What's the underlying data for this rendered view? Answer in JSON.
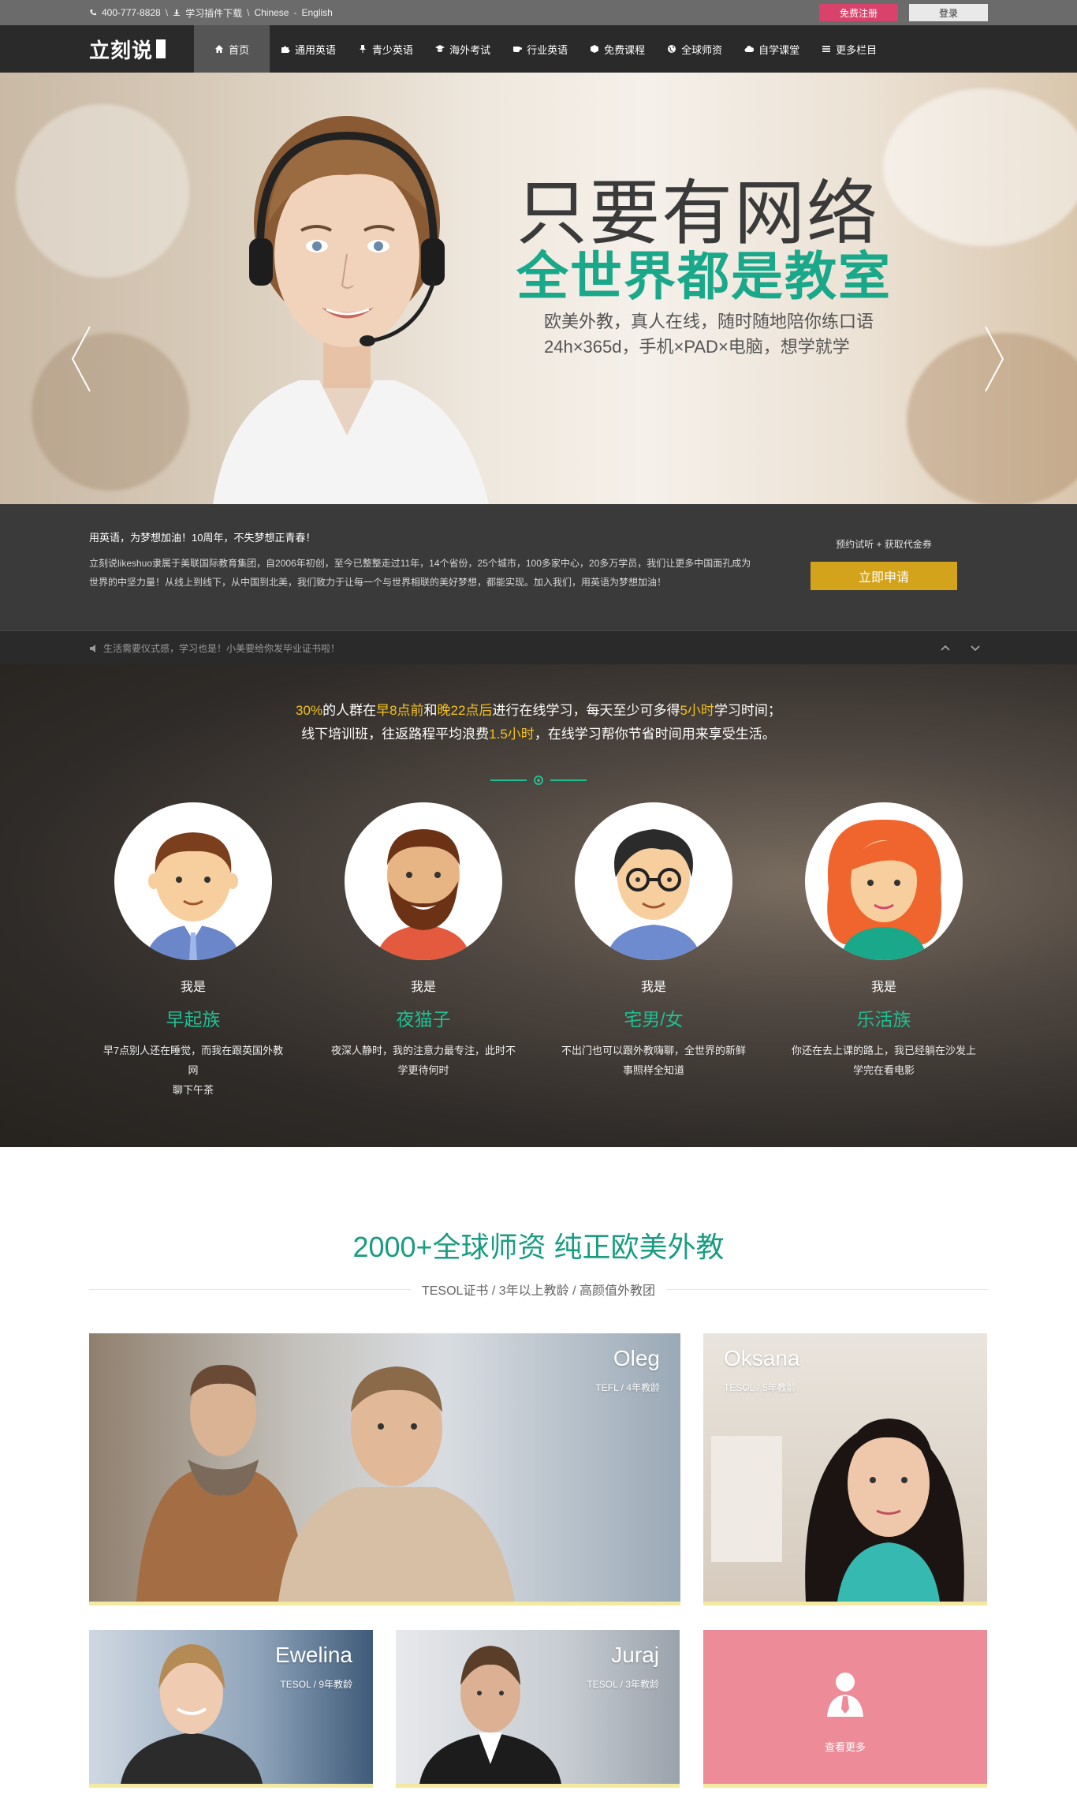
{
  "topbar": {
    "phone": "400-777-8828",
    "download": "学习插件下载",
    "lang_cn": "Chinese",
    "lang_en": "English",
    "register": "免费注册",
    "login": "登录"
  },
  "nav": {
    "logo": "立刻说",
    "items": [
      "首页",
      "通用英语",
      "青少英语",
      "海外考试",
      "行业英语",
      "免费课程",
      "全球师资",
      "自学课堂",
      "更多栏目"
    ]
  },
  "hero": {
    "title": "只要有网络",
    "subtitle": "全世界都是教室",
    "line1": "欧美外教，真人在线，随时随地陪你练口语",
    "line2": "24h×365d，手机×PAD×电脑，想学就学"
  },
  "intro": {
    "headline": "用英语，为梦想加油！10周年，不失梦想正青春！",
    "body": "立刻说likeshuo隶属于美联国际教育集团，自2006年初创，至今已整整走过11年，14个省份，25个城市，100多家中心，20多万学员，我们让更多中国面孔成为世界的中坚力量！从线上到线下，从中国到北美，我们致力于让每一个与世界相联的美好梦想，都能实现。加入我们，用英语为梦想加油！",
    "cta_label": "预约试听 + 获取代金券",
    "cta_button": "立即申请"
  },
  "notice": {
    "text": "生活需要仪式感，学习也是！小美要给你发毕业证书啦！"
  },
  "audience": {
    "line1": [
      "30%",
      "的人群在",
      "早8点前",
      "和",
      "晚22点后",
      "进行在线学习，每天至少可多得",
      "5小时",
      "学习时间；"
    ],
    "line2": [
      "线下培训班，往返路程平均浪费",
      "1.5小时",
      "，在线学习帮你节省时间用来享受生活。"
    ],
    "personas": [
      {
        "pre": "我是",
        "name": "早起族",
        "desc1": "早7点别人还在睡觉，而我在跟英国外教网",
        "desc2": "聊下午茶"
      },
      {
        "pre": "我是",
        "name": "夜猫子",
        "desc1": "夜深人静时，我的注意力最专注，此时不",
        "desc2": "学更待何时"
      },
      {
        "pre": "我是",
        "name": "宅男/女",
        "desc1": "不出门也可以跟外教嗨聊，全世界的新鲜",
        "desc2": "事照样全知道"
      },
      {
        "pre": "我是",
        "name": "乐活族",
        "desc1": "你还在去上课的路上，我已经躺在沙发上",
        "desc2": "学完在看电影"
      }
    ]
  },
  "teachers": {
    "title": "2000+全球师资 纯正欧美外教",
    "subtitle": "TESOL证书 / 3年以上教龄 / 高颜值外教团",
    "cards": [
      {
        "name": "Oleg",
        "info": "TEFL / 4年教龄"
      },
      {
        "name": "Oksana",
        "info": "TESOL / 5年教龄"
      },
      {
        "name": "Ewelina",
        "info": "TESOL / 9年教龄"
      },
      {
        "name": "Juraj",
        "info": "TESOL / 3年教龄"
      }
    ],
    "more": "查看更多"
  }
}
